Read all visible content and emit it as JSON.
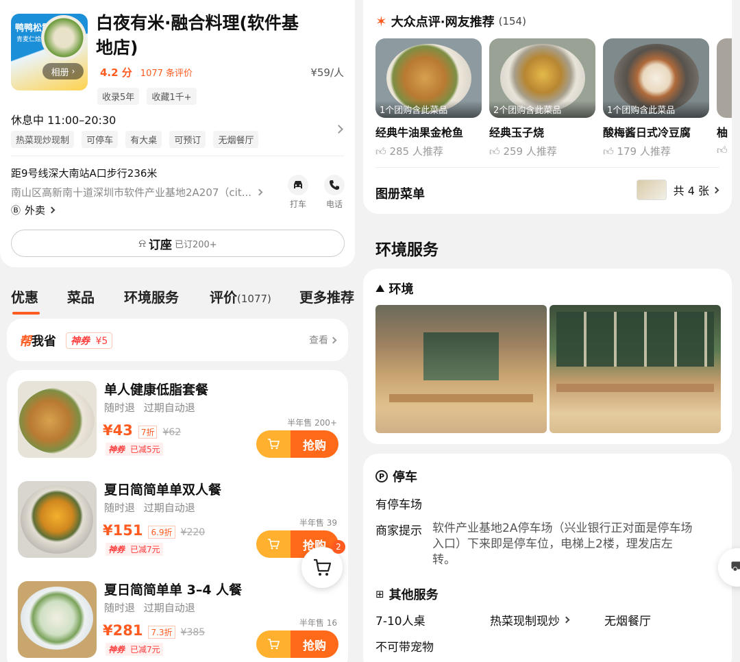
{
  "shop": {
    "name_line1": "白夜有米·融合料理(软件基",
    "name_line2": "地店)",
    "rating": "4.2 分",
    "reviews": "1077 条评价",
    "price": "¥59/人",
    "badges": [
      "收录5年",
      "收藏1千+"
    ],
    "album_label": "相册",
    "thumb_title": "鸭鸭松露",
    "thumb_sub": "青麦仁烩饭",
    "hours": "休息中  11:00–20:30",
    "tags": [
      "热菜现炒现制",
      "可停车",
      "有大桌",
      "可预订",
      "无烟餐厅"
    ],
    "distance": "距9号线深大南站A口步行236米",
    "address": "南山区高新南十道深圳市软件产业基地2A207（cit...",
    "taxi_label": "打车",
    "phone_label": "电话",
    "takeout_label": "外卖",
    "book_label": "订座",
    "book_count": "已订200+"
  },
  "tabs": [
    {
      "label": "优惠",
      "active": true
    },
    {
      "label": "菜品"
    },
    {
      "label": "环境服务"
    },
    {
      "label": "评价",
      "count": "(1077)"
    },
    {
      "label": "更多推荐"
    }
  ],
  "save": {
    "title_a": "帮",
    "title_b": "我省",
    "badge": "神券",
    "amount": "¥5",
    "view": "查看"
  },
  "deals": [
    {
      "title": "单人健康低脂套餐",
      "refund1": "随时退",
      "refund2": "过期自动退",
      "price": "¥43",
      "discount": "7折",
      "orig": "¥62",
      "coupon": "神券",
      "minus": "已减5元",
      "sold": "半年售 200+",
      "buy": "抢购"
    },
    {
      "title": "夏日简简单单双人餐",
      "refund1": "随时退",
      "refund2": "过期自动退",
      "price": "¥151",
      "discount": "6.9折",
      "orig": "¥220",
      "coupon": "神券",
      "minus": "已减7元",
      "sold": "半年售 39",
      "buy": "抢购"
    },
    {
      "title": "夏日简简单单 3–4 人餐",
      "refund1": "随时退",
      "refund2": "过期自动退",
      "price": "¥281",
      "discount": "7.3折",
      "orig": "¥385",
      "coupon": "神券",
      "minus": "已减7元",
      "sold": "半年售 16",
      "buy": "抢购"
    }
  ],
  "cart_badge": "2",
  "recommend": {
    "title": "大众点评·网友推荐",
    "count": "(154)",
    "dishes": [
      {
        "caption": "1个团购含此菜品",
        "name": "经典牛油果金枪鱼",
        "likes": "285 人推荐"
      },
      {
        "caption": "2个团购含此菜品",
        "name": "经典玉子烧",
        "likes": "259 人推荐"
      },
      {
        "caption": "1个团购含此菜品",
        "name": "酸梅酱日式冷豆腐",
        "likes": "179 人推荐"
      },
      {
        "caption": "",
        "name": "柚",
        "likes": ""
      }
    ],
    "menu_label": "图册菜单",
    "menu_count": "共 4 张"
  },
  "env_service": {
    "heading": "环境服务",
    "env_label": "环境",
    "parking_label": "停车",
    "parking_value": "有停车场",
    "tip_label": "商家提示",
    "tip_text_1": "软件产业基地2A停车场（兴业银行正对面是停车场",
    "tip_text_2": "入口）下来即是停车位，电梯上2楼，理发店左",
    "tip_text_3": "转。",
    "other_label": "其他服务",
    "others": [
      "7-10人桌",
      "热菜现制现炒",
      "无烟餐厅",
      "不可带宠物"
    ]
  },
  "colors": {
    "accent": "#ff5a1f",
    "button": "#ff6a1a",
    "button_light": "#ffb02e"
  }
}
